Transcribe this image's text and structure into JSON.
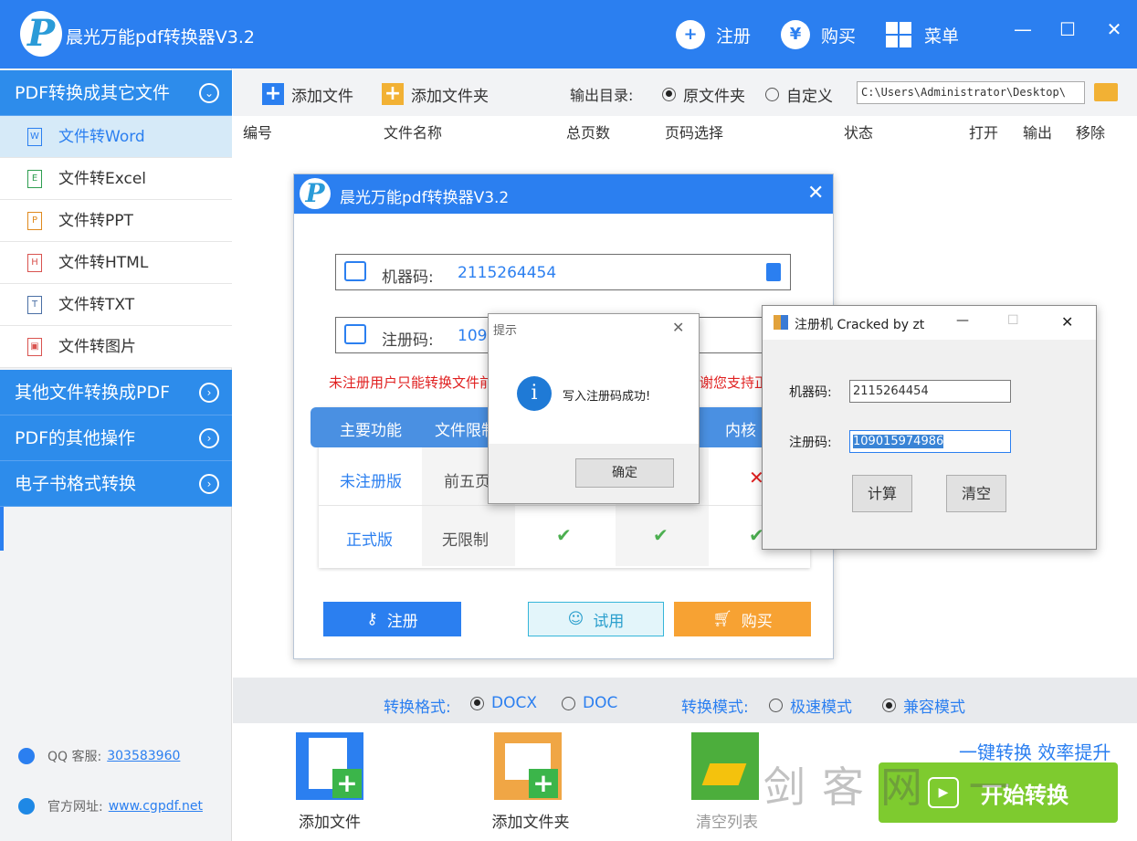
{
  "app": {
    "logo": "P",
    "title": "晨光万能pdf转换器V3.2"
  },
  "topbar": {
    "register": "注册",
    "buy": "购买",
    "menu": "菜单",
    "register_icon": "user-plus-icon",
    "buy_icon": "yen-icon",
    "menu_icon": "grid-icon"
  },
  "window_controls": {
    "minimize": "—",
    "maximize": "☐",
    "close": "✕"
  },
  "sidebar": {
    "section1": "PDF转换成其它文件",
    "items": [
      {
        "label": "文件转Word",
        "icon": "W"
      },
      {
        "label": "文件转Excel",
        "icon": "E"
      },
      {
        "label": "文件转PPT",
        "icon": "P"
      },
      {
        "label": "文件转HTML",
        "icon": "H"
      },
      {
        "label": "文件转TXT",
        "icon": "T"
      },
      {
        "label": "文件转图片",
        "icon": "▣"
      }
    ],
    "section2": "其他文件转换成PDF",
    "section3": "PDF的其他操作",
    "section4": "电子书格式转换",
    "qq_label": "QQ 客服:",
    "qq_value": "303583960",
    "site_label": "官方网址:",
    "site_value": "www.cgpdf.net"
  },
  "toolbar": {
    "add_file": "添加文件",
    "add_folder": "添加文件夹",
    "output_label": "输出目录:",
    "opt_original": "原文件夹",
    "opt_custom": "自定义",
    "output_path": "C:\\Users\\Administrator\\Desktop\\"
  },
  "table_headers": [
    "编号",
    "文件名称",
    "总页数",
    "页码选择",
    "状态",
    "打开",
    "输出",
    "移除"
  ],
  "format_bar": {
    "format_label": "转换格式:",
    "docx": "DOCX",
    "doc": "DOC",
    "mode_label": "转换模式:",
    "fast": "极速模式",
    "compat": "兼容模式"
  },
  "bottom": {
    "add_file": "添加文件",
    "add_folder": "添加文件夹",
    "clear_list": "清空列表",
    "slogan": "一键转换 效率提升",
    "start": "开始转换",
    "watermark": "剑客网 一"
  },
  "reg_dialog": {
    "title": "晨光万能pdf转换器V3.2",
    "machine_label": "机器码:",
    "machine_value": "2115264454",
    "reg_label": "注册码:",
    "reg_value": "109",
    "warning_left": "未注册用户只能转换文件前",
    "warning_right": "谢您支持正",
    "table_head": [
      "主要功能",
      "文件限制",
      "内核"
    ],
    "row1": {
      "name": "未注册版",
      "limit": "前五页",
      "mark": "✕"
    },
    "row2": {
      "name": "正式版",
      "limit": "无限制",
      "marks": [
        "✔",
        "✔",
        "✔"
      ]
    },
    "btn_register": "注册",
    "btn_trial": "试用",
    "btn_buy": "购买"
  },
  "message_box": {
    "title": "提示",
    "text": "写入注册码成功!",
    "ok": "确定",
    "icon": "i"
  },
  "keygen": {
    "title": "注册机 Cracked by zt",
    "machine_label": "机器码:",
    "machine_value": "2115264454",
    "reg_label": "注册码:",
    "reg_value": "109015974986",
    "calc": "计算",
    "clear": "清空"
  }
}
